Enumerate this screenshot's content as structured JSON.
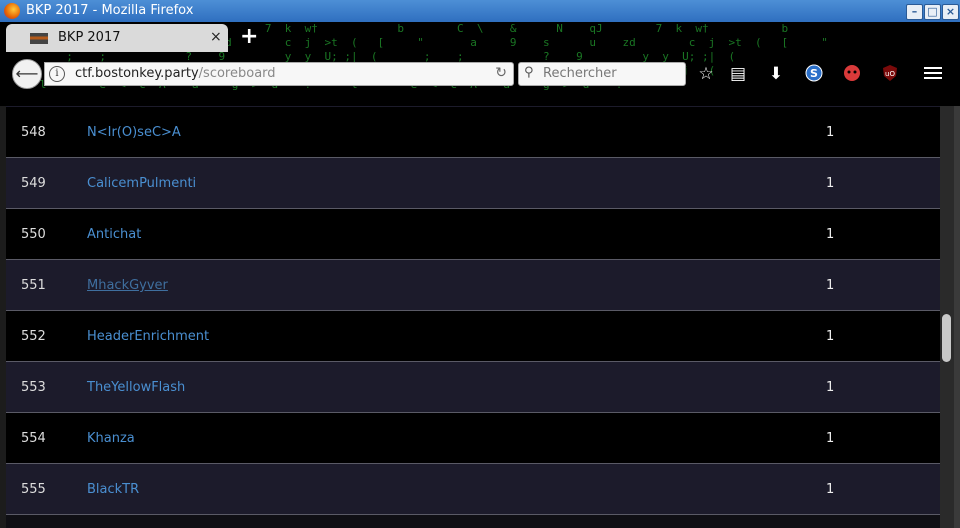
{
  "window": {
    "title": "BKP 2017 - Mozilla Firefox"
  },
  "tab": {
    "title": "BKP 2017",
    "close_glyph": "×",
    "new_tab_glyph": "+"
  },
  "navbar": {
    "back_glyph": "⟵",
    "info_glyph": "i",
    "url_domain": "ctf.bostonkey.party",
    "url_path": "/scoreboard",
    "reload_glyph": "↻",
    "search_placeholder": "Rechercher",
    "search_glyph": "⚲",
    "icons": [
      "star-icon",
      "reading-list-icon",
      "download-icon",
      "s-extension-icon",
      "addon-red-icon",
      "ublock-icon",
      "menu-icon"
    ]
  },
  "scoreboard": {
    "rows": [
      {
        "rank": "548",
        "team": "N<Ir(O)seC>A",
        "score": "1"
      },
      {
        "rank": "549",
        "team": "CalicemPulmenti",
        "score": "1"
      },
      {
        "rank": "550",
        "team": "Antichat",
        "score": "1"
      },
      {
        "rank": "551",
        "team": "MhackGyver",
        "score": "1"
      },
      {
        "rank": "552",
        "team": "HeaderEnrichment",
        "score": "1"
      },
      {
        "rank": "553",
        "team": "TheYellowFlash",
        "score": "1"
      },
      {
        "rank": "554",
        "team": "Khanza",
        "score": "1"
      },
      {
        "rank": "555",
        "team": "BlackTR",
        "score": "1"
      }
    ]
  },
  "colors": {
    "link": "#4a8fd1",
    "row_dark": "#000000",
    "row_alt": "#1c1b2b",
    "titlebar": "#3a7fce",
    "matrix_green": "#1f8a2a"
  }
}
